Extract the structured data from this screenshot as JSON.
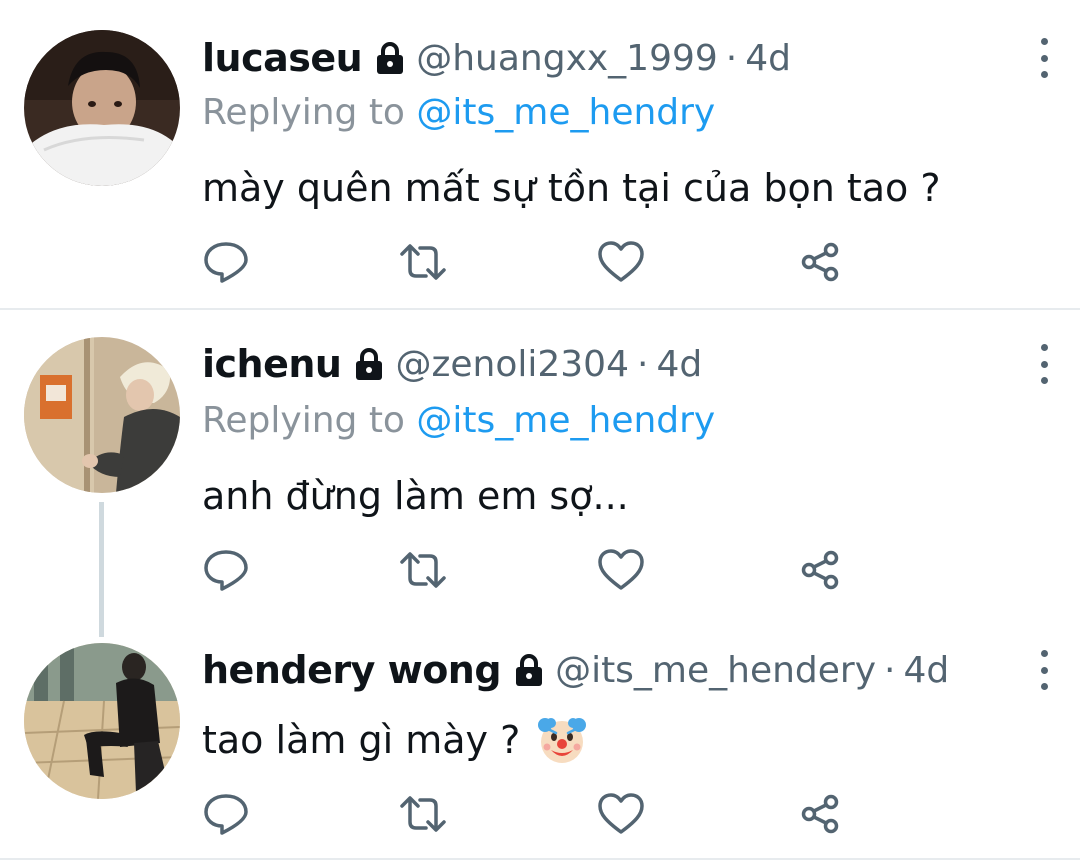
{
  "tweets": [
    {
      "name": "lucaseu",
      "handle": "@huangxx_1999",
      "separator": "·",
      "time": "4d",
      "replying_prefix": "Replying to ",
      "replying_to": "@its_me_hendry",
      "text": "mày quên mất sự tồn tại của bọn tao ?"
    },
    {
      "name": "ichenu",
      "handle": "@zenoli2304",
      "separator": "·",
      "time": "4d",
      "replying_prefix": "Replying to ",
      "replying_to": "@its_me_hendry",
      "text": "anh đừng làm em sợ..."
    },
    {
      "name": "hendery wong",
      "handle": "@its_me_hendery",
      "separator": "·",
      "time": "4d",
      "text": "tao làm gì mày ?",
      "emoji": "clown-face"
    }
  ],
  "icons": {
    "lock": "lock-icon",
    "more": "more-vertical-icon",
    "reply": "reply-icon",
    "retweet": "retweet-icon",
    "like": "heart-icon",
    "share": "share-icon"
  },
  "colors": {
    "text": "#0f1419",
    "secondary": "#536471",
    "mention": "#1d9bf0",
    "thread_line": "#cfd9de",
    "divider": "#e7ebee"
  }
}
